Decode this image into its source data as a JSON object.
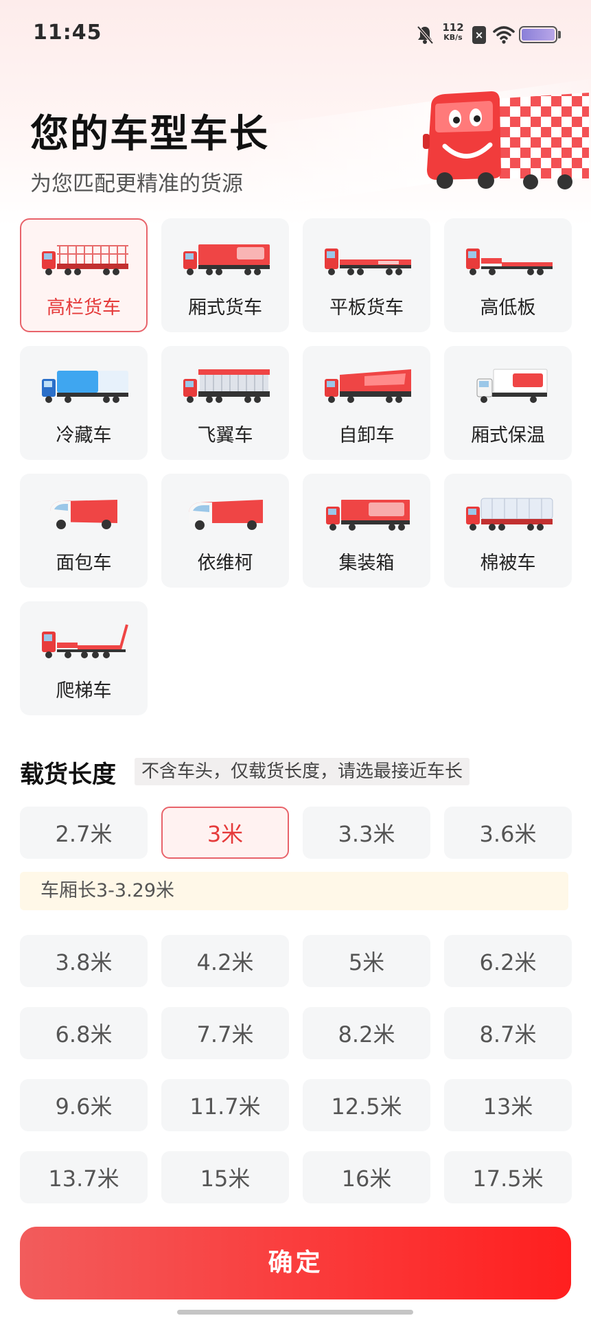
{
  "status_bar": {
    "time": "11:45",
    "net_speed_value": "112",
    "net_speed_unit": "KB/s",
    "sim_badge": "×",
    "icons": [
      "bell-muted-icon",
      "sim-off-icon",
      "wifi-icon",
      "battery-icon"
    ]
  },
  "header": {
    "title": "您的车型车长",
    "subtitle": "为您匹配更精准的货源"
  },
  "vehicle_types": [
    {
      "label": "高栏货车",
      "selected": true,
      "icon": "high-rail-truck-icon"
    },
    {
      "label": "厢式货车",
      "selected": false,
      "icon": "box-truck-icon"
    },
    {
      "label": "平板货车",
      "selected": false,
      "icon": "flatbed-truck-icon"
    },
    {
      "label": "高低板",
      "selected": false,
      "icon": "lowbed-truck-icon"
    },
    {
      "label": "冷藏车",
      "selected": false,
      "icon": "refrigerated-truck-icon"
    },
    {
      "label": "飞翼车",
      "selected": false,
      "icon": "wing-truck-icon"
    },
    {
      "label": "自卸车",
      "selected": false,
      "icon": "dump-truck-icon"
    },
    {
      "label": "厢式保温",
      "selected": false,
      "icon": "insulated-truck-icon"
    },
    {
      "label": "面包车",
      "selected": false,
      "icon": "minivan-icon"
    },
    {
      "label": "依维柯",
      "selected": false,
      "icon": "iveco-van-icon"
    },
    {
      "label": "集装箱",
      "selected": false,
      "icon": "container-truck-icon"
    },
    {
      "label": "棉被车",
      "selected": false,
      "icon": "quilt-truck-icon"
    },
    {
      "label": "爬梯车",
      "selected": false,
      "icon": "ladder-truck-icon"
    }
  ],
  "length_section": {
    "title": "载货长度",
    "hint": "不含车头，仅载货长度，请选最接近车长",
    "selected_note": "车厢长3-3.29米",
    "options": [
      "2.7米",
      "3米",
      "3.3米",
      "3.6米",
      "3.8米",
      "4.2米",
      "5米",
      "6.2米",
      "6.8米",
      "7.7米",
      "8.2米",
      "8.7米",
      "9.6米",
      "11.7米",
      "12.5米",
      "13米",
      "13.7米",
      "15米",
      "16米",
      "17.5米"
    ],
    "selected": "3米"
  },
  "confirm_label": "确定",
  "colors": {
    "accent": "#e53b3b",
    "selected_border": "#e8636a",
    "card_bg": "#f5f6f7",
    "note_bg": "#fff8e8",
    "confirm_start": "#f25c5c",
    "confirm_end": "#ff1f1f"
  }
}
